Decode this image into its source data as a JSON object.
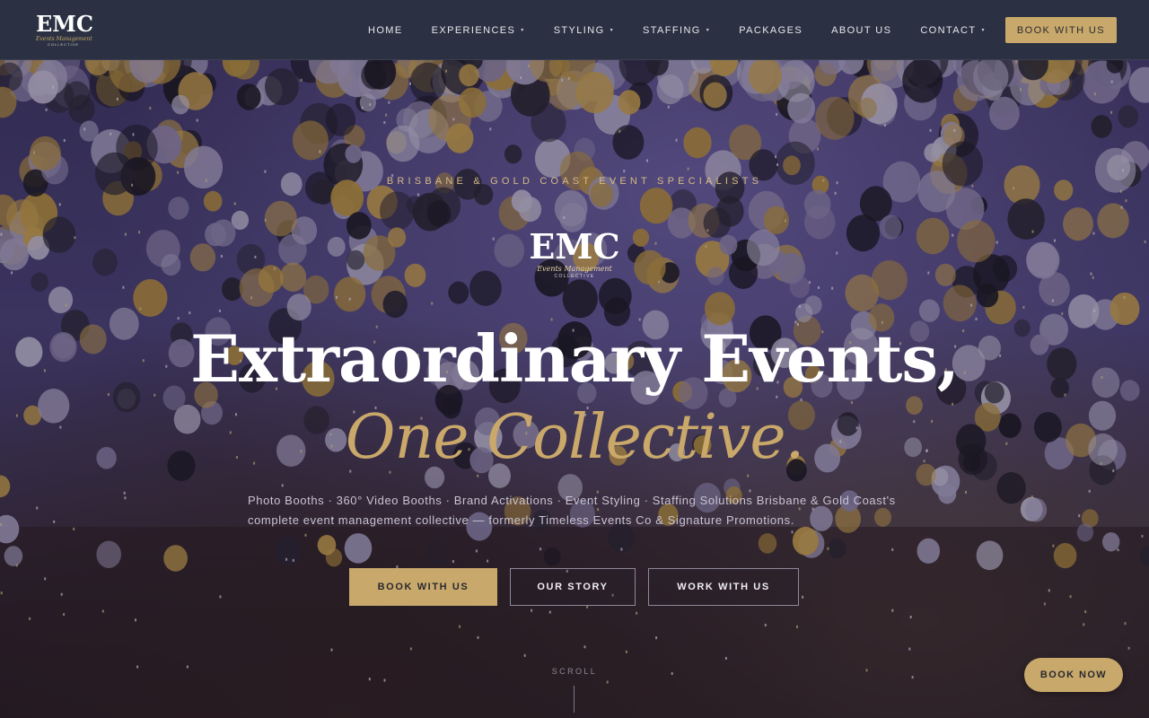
{
  "brand": {
    "logo_mark": "EMC",
    "logo_script": "Events Management",
    "logo_sub": "COLLECTIVE"
  },
  "nav": {
    "items": [
      {
        "label": "HOME",
        "has_dropdown": false
      },
      {
        "label": "EXPERIENCES",
        "has_dropdown": true
      },
      {
        "label": "STYLING",
        "has_dropdown": true
      },
      {
        "label": "STAFFING",
        "has_dropdown": true
      },
      {
        "label": "PACKAGES",
        "has_dropdown": false
      },
      {
        "label": "ABOUT US",
        "has_dropdown": false
      },
      {
        "label": "CONTACT",
        "has_dropdown": true
      }
    ],
    "cta_label": "BOOK WITH US",
    "caret": "▾"
  },
  "hero": {
    "eyebrow": "BRISBANE & GOLD COAST EVENT SPECIALISTS",
    "headline": "Extraordinary Events,",
    "headline_accent": "One Collective.",
    "description": "Photo Booths · 360° Video Booths · Brand Activations · Event Styling · Staffing Solutions Brisbane & Gold Coast's complete event management collective — formerly Timeless Events Co & Signature Promotions.",
    "buttons": {
      "book": "BOOK WITH US",
      "story": "OUR STORY",
      "work": "WORK WITH US"
    },
    "scroll_label": "SCROLL"
  },
  "floating_cta": "BOOK NOW",
  "colors": {
    "accent_gold": "#c8a96b",
    "nav_bg": "#2b3142"
  }
}
